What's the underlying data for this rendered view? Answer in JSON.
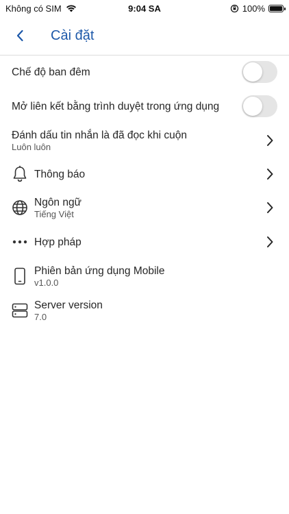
{
  "status_bar": {
    "carrier": "Không có SIM",
    "time": "9:04 SA",
    "battery": "100%"
  },
  "header": {
    "title": "Cài đặt"
  },
  "settings": {
    "night_mode": {
      "label": "Chế độ ban đêm",
      "enabled": false
    },
    "in_app_browser": {
      "label": "Mở liên kết bằng trình duyệt trong ứng dụng",
      "enabled": false
    },
    "mark_read": {
      "label": "Đánh dấu tin nhắn là đã đọc khi cuộn",
      "value": "Luôn luôn"
    },
    "notifications": {
      "label": "Thông báo"
    },
    "language": {
      "label": "Ngôn ngữ",
      "value": "Tiếng Việt"
    },
    "legal": {
      "label": "Hợp pháp"
    },
    "app_version": {
      "label": "Phiên bản ứng dụng Mobile",
      "value": "v1.0.0"
    },
    "server_version": {
      "label": "Server version",
      "value": "7.0"
    }
  },
  "colors": {
    "accent": "#1c58a9",
    "toggle_off": "#e5e5e5"
  }
}
